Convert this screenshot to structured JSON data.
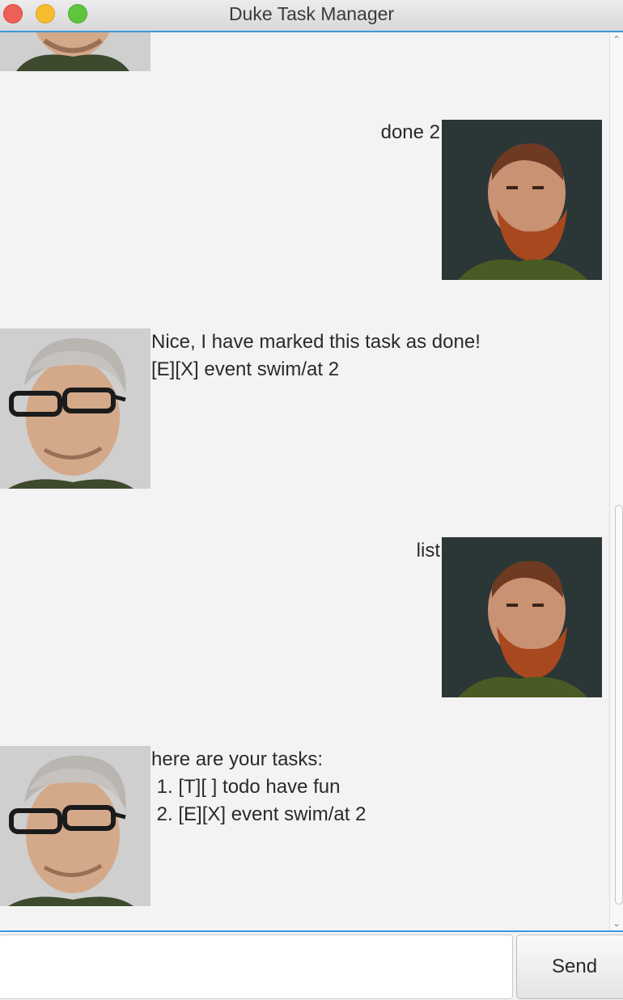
{
  "window": {
    "title": "Duke Task Manager"
  },
  "colors": {
    "accent": "#3a9ad9",
    "close": "#ee5f56",
    "minimize": "#f6bd2e",
    "maximize": "#5fc53f",
    "chat_background": "#f3f3f3"
  },
  "icons": {
    "close": "close-traffic-light",
    "minimize": "minimize-traffic-light",
    "maximize": "maximize-traffic-light",
    "scroll_up": "chevron-up-icon",
    "scroll_down": "chevron-down-icon"
  },
  "messages": [
    {
      "sender": "duke",
      "text": ""
    },
    {
      "sender": "user",
      "text": "done 2"
    },
    {
      "sender": "duke",
      "lines": [
        "Nice, I have marked this task as done!",
        "[E][X] event swim/at 2"
      ]
    },
    {
      "sender": "user",
      "text": "list"
    },
    {
      "sender": "duke",
      "lines": [
        "here are your tasks:",
        " 1. [T][ ] todo have fun",
        " 2. [E][X] event swim/at 2"
      ]
    }
  ],
  "input": {
    "value": "",
    "placeholder": ""
  },
  "send_button": {
    "label": "Send"
  }
}
